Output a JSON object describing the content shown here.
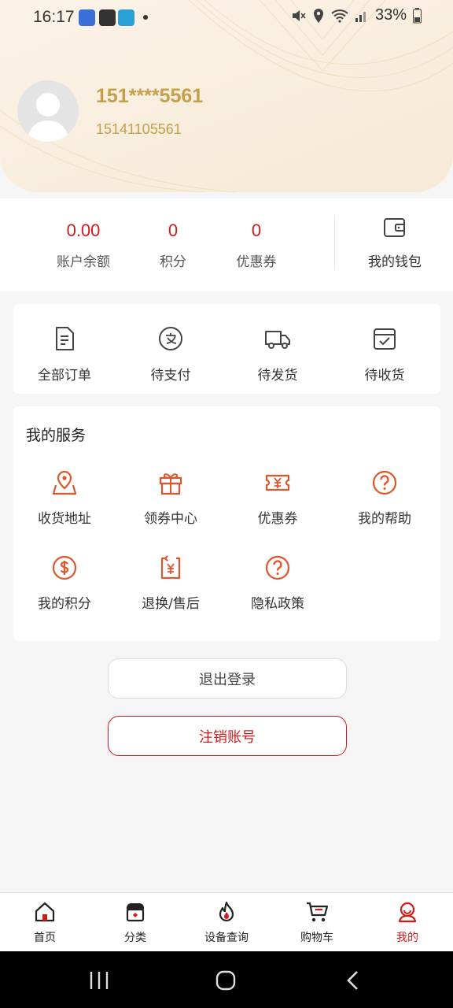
{
  "status": {
    "time": "16:17",
    "battery": "33%"
  },
  "user": {
    "masked_phone": "151****5561",
    "phone": "15141105561"
  },
  "stats": [
    {
      "value": "0.00",
      "label": "账户余额"
    },
    {
      "value": "0",
      "label": "积分"
    },
    {
      "value": "0",
      "label": "优惠券"
    }
  ],
  "wallet": {
    "label": "我的钱包",
    "icon": "wallet-icon"
  },
  "orders": [
    {
      "label": "全部订单",
      "icon": "document-icon"
    },
    {
      "label": "待支付",
      "icon": "alipay-icon"
    },
    {
      "label": "待发货",
      "icon": "truck-icon"
    },
    {
      "label": "待收货",
      "icon": "box-check-icon"
    }
  ],
  "services": {
    "title": "我的服务",
    "items": [
      {
        "label": "收货地址",
        "icon": "map-pin-icon"
      },
      {
        "label": "领券中心",
        "icon": "gift-icon"
      },
      {
        "label": "优惠券",
        "icon": "coupon-icon"
      },
      {
        "label": "我的帮助",
        "icon": "help-icon"
      },
      {
        "label": "我的积分",
        "icon": "dollar-coin-icon"
      },
      {
        "label": "退换/售后",
        "icon": "refund-icon"
      },
      {
        "label": "隐私政策",
        "icon": "question-icon"
      }
    ]
  },
  "buttons": {
    "logout": "退出登录",
    "cancel_account": "注销账号"
  },
  "nav": [
    {
      "label": "首页",
      "icon": "home-icon"
    },
    {
      "label": "分类",
      "icon": "category-icon"
    },
    {
      "label": "设备查询",
      "icon": "fire-icon"
    },
    {
      "label": "购物车",
      "icon": "cart-icon"
    },
    {
      "label": "我的",
      "icon": "profile-icon",
      "active": true
    }
  ],
  "colors": {
    "accent": "#d31a1a",
    "gold": "#c4a04a",
    "service_icon": "#e0562a"
  }
}
